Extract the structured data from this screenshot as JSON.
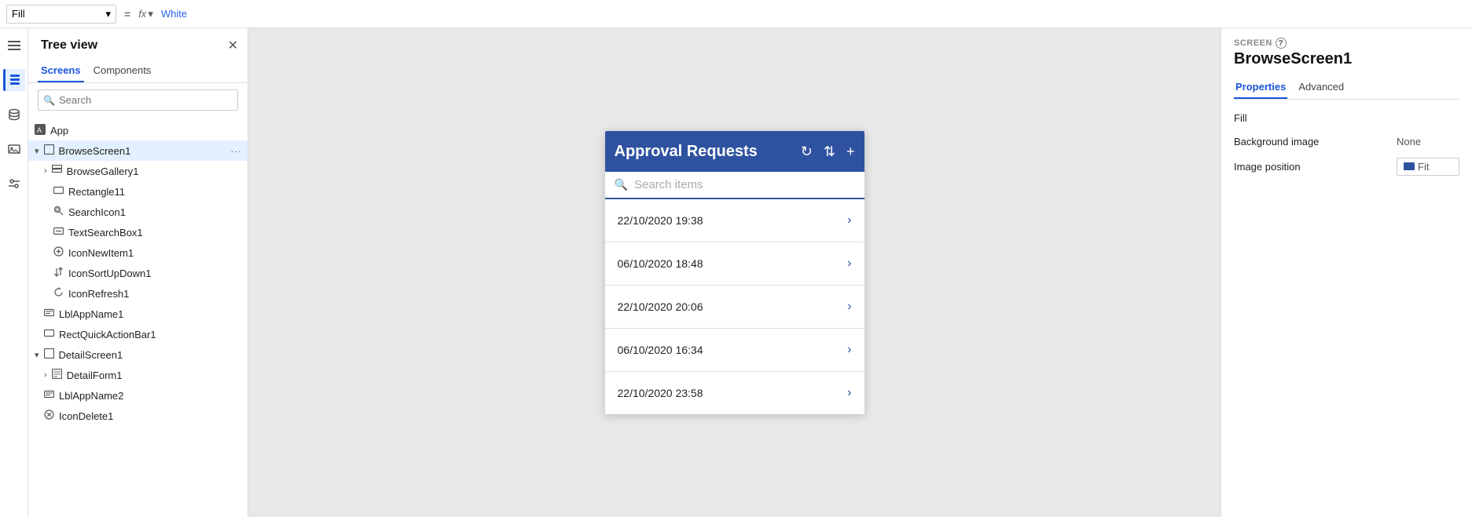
{
  "formulaBar": {
    "property": "Fill",
    "equals": "=",
    "fx": "fx",
    "value": "White"
  },
  "treeView": {
    "title": "Tree view",
    "tabs": [
      "Screens",
      "Components"
    ],
    "activeTab": "Screens",
    "searchPlaceholder": "Search",
    "items": [
      {
        "id": "app",
        "label": "App",
        "level": 0,
        "type": "app",
        "expanded": false
      },
      {
        "id": "browseScreen1",
        "label": "BrowseScreen1",
        "level": 0,
        "type": "screen",
        "expanded": true,
        "hasEllipsis": true
      },
      {
        "id": "browseGallery1",
        "label": "BrowseGallery1",
        "level": 1,
        "type": "gallery",
        "expanded": false,
        "hasChevron": true
      },
      {
        "id": "rectangle11",
        "label": "Rectangle11",
        "level": 2,
        "type": "rectangle"
      },
      {
        "id": "searchIcon1",
        "label": "SearchIcon1",
        "level": 2,
        "type": "icon"
      },
      {
        "id": "textSearchBox1",
        "label": "TextSearchBox1",
        "level": 2,
        "type": "input"
      },
      {
        "id": "iconNewItem1",
        "label": "IconNewItem1",
        "level": 2,
        "type": "icon"
      },
      {
        "id": "iconSortUpDown1",
        "label": "IconSortUpDown1",
        "level": 2,
        "type": "icon"
      },
      {
        "id": "iconRefresh1",
        "label": "IconRefresh1",
        "level": 2,
        "type": "icon"
      },
      {
        "id": "lblAppName1",
        "label": "LblAppName1",
        "level": 1,
        "type": "label"
      },
      {
        "id": "rectQuickActionBar1",
        "label": "RectQuickActionBar1",
        "level": 1,
        "type": "rectangle"
      },
      {
        "id": "detailScreen1",
        "label": "DetailScreen1",
        "level": 0,
        "type": "screen",
        "expanded": true
      },
      {
        "id": "detailForm1",
        "label": "DetailForm1",
        "level": 1,
        "type": "form",
        "hasChevron": true
      },
      {
        "id": "lblAppName2",
        "label": "LblAppName2",
        "level": 1,
        "type": "label"
      },
      {
        "id": "iconDelete1",
        "label": "IconDelete1",
        "level": 1,
        "type": "icon"
      }
    ]
  },
  "appPreview": {
    "title": "Approval Requests",
    "searchPlaceholder": "Search items",
    "items": [
      {
        "date": "22/10/2020 19:38"
      },
      {
        "date": "06/10/2020 18:48"
      },
      {
        "date": "22/10/2020 20:06"
      },
      {
        "date": "06/10/2020 16:34"
      },
      {
        "date": "22/10/2020 23:58"
      }
    ]
  },
  "rightPanel": {
    "screenLabel": "SCREEN",
    "helpIcon": "?",
    "screenName": "BrowseScreen1",
    "tabs": [
      "Properties",
      "Advanced"
    ],
    "activeTab": "Properties",
    "fillLabel": "Fill",
    "backgroundImageLabel": "Background image",
    "backgroundImageValue": "None",
    "imagePositionLabel": "Image position",
    "imagePositionValue": "Fit"
  },
  "icons": {
    "menu": "☰",
    "treeViewIcon": "⋮",
    "search": "🔍",
    "close": "✕",
    "chevronRight": "›",
    "chevronDown": "▾",
    "chevronLeft": "‹",
    "ellipsis": "⋯",
    "plus": "+",
    "refresh": "↻",
    "sort": "⇅",
    "navTree": "🌳",
    "navData": "🗄",
    "navMedia": "🖼",
    "navSettings": "⚙"
  }
}
